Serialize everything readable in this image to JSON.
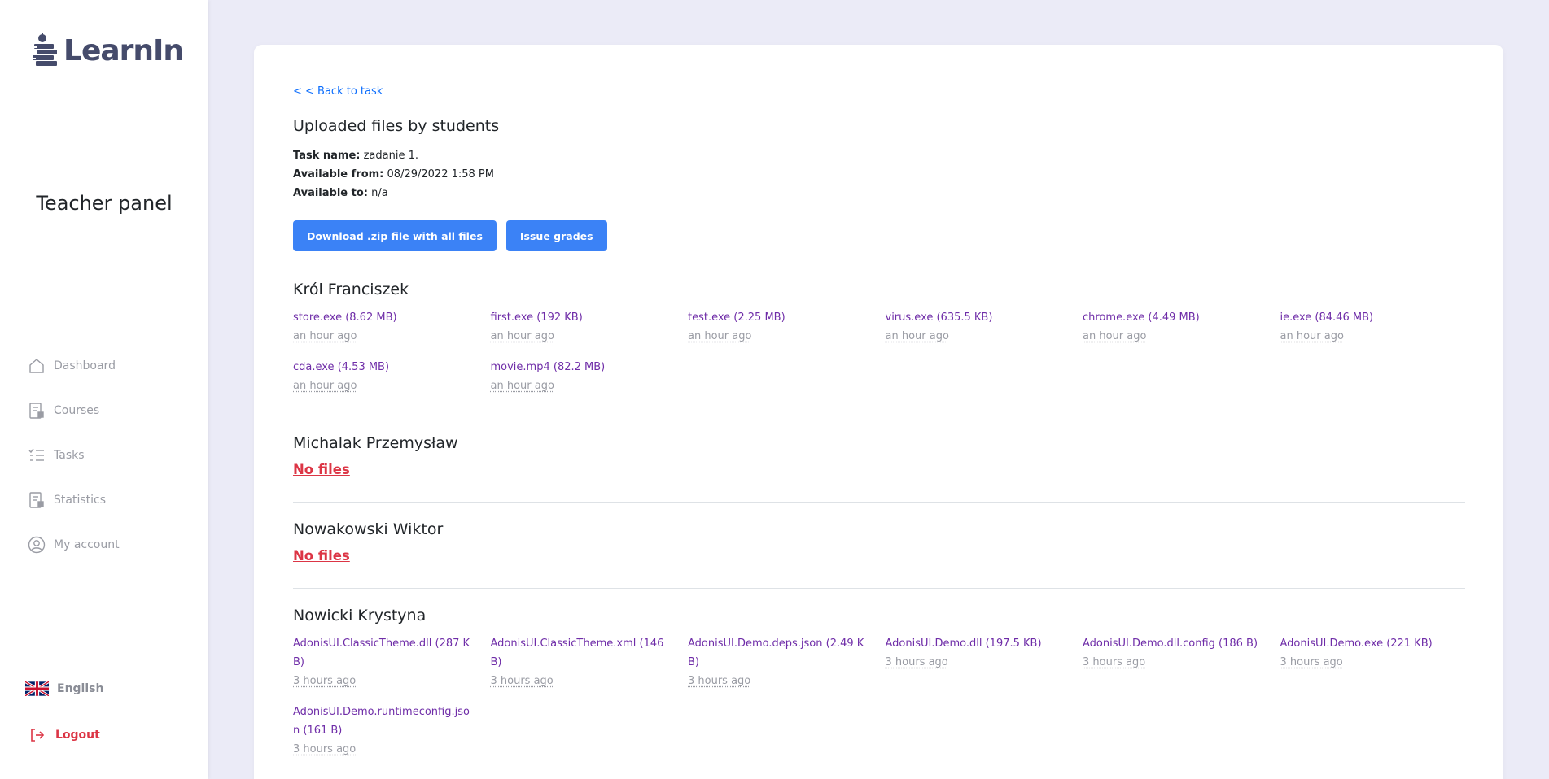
{
  "app": {
    "name": "LearnIn",
    "panel_title": "Teacher panel"
  },
  "sidebar": {
    "items": [
      {
        "label": "Dashboard",
        "icon": "home-icon"
      },
      {
        "label": "Courses",
        "icon": "courses-icon"
      },
      {
        "label": "Tasks",
        "icon": "tasks-icon"
      },
      {
        "label": "Statistics",
        "icon": "statistics-icon"
      },
      {
        "label": "My account",
        "icon": "user-icon"
      }
    ],
    "language": "English",
    "logout": "Logout"
  },
  "main": {
    "back_link": "< < Back to task",
    "title": "Uploaded files by students",
    "task_name_label": "Task name:",
    "task_name": "zadanie 1.",
    "available_from_label": "Available from:",
    "available_from": "08/29/2022 1:58 PM",
    "available_to_label": "Available to:",
    "available_to": "n/a",
    "download_button": "Download .zip file with all files",
    "grades_button": "Issue grades",
    "no_files_label": "No files"
  },
  "students": [
    {
      "name": "Król Franciszek",
      "files": [
        {
          "name": "store.exe (8.62 MB)",
          "time": "an hour ago"
        },
        {
          "name": "first.exe (192 KB)",
          "time": "an hour ago"
        },
        {
          "name": "test.exe (2.25 MB)",
          "time": "an hour ago"
        },
        {
          "name": "virus.exe (635.5 KB)",
          "time": "an hour ago"
        },
        {
          "name": "chrome.exe (4.49 MB)",
          "time": "an hour ago"
        },
        {
          "name": "ie.exe (84.46 MB)",
          "time": "an hour ago"
        },
        {
          "name": "cda.exe (4.53 MB)",
          "time": "an hour ago"
        },
        {
          "name": "movie.mp4 (82.2 MB)",
          "time": "an hour ago"
        }
      ]
    },
    {
      "name": "Michalak Przemysław",
      "files": []
    },
    {
      "name": "Nowakowski Wiktor",
      "files": []
    },
    {
      "name": "Nowicki Krystyna",
      "files": [
        {
          "name": "AdonisUI.ClassicTheme.dll (287 KB)",
          "time": "3 hours ago"
        },
        {
          "name": "AdonisUI.ClassicTheme.xml (146 B)",
          "time": "3 hours ago"
        },
        {
          "name": "AdonisUI.Demo.deps.json (2.49 KB)",
          "time": "3 hours ago"
        },
        {
          "name": "AdonisUI.Demo.dll (197.5 KB)",
          "time": "3 hours ago"
        },
        {
          "name": "AdonisUI.Demo.dll.config (186 B)",
          "time": "3 hours ago"
        },
        {
          "name": "AdonisUI.Demo.exe (221 KB)",
          "time": "3 hours ago"
        },
        {
          "name": "AdonisUI.Demo.runtimeconfig.json (161 B)",
          "time": "3 hours ago"
        }
      ]
    }
  ],
  "colors": {
    "accent": "#3b82f6",
    "link": "#0d6efd",
    "file_link": "#6f2da8",
    "danger": "#dc3545",
    "background": "#ebebf7",
    "logo": "#454b6b"
  }
}
